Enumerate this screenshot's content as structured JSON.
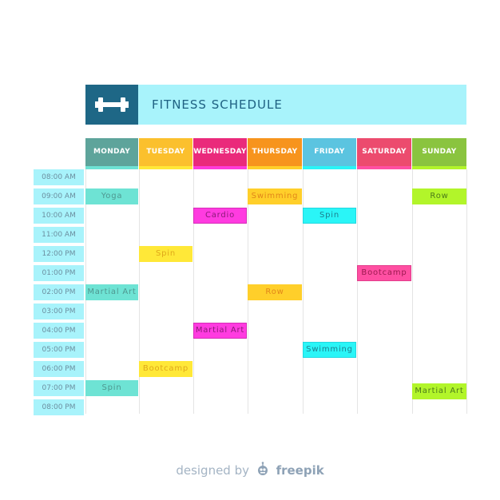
{
  "header": {
    "title": "FITNESS SCHEDULE",
    "icon": "dumbbell-icon",
    "colors": {
      "band": "#a8f3fb",
      "logo_box": "#1e6786",
      "title_text": "#1f6283"
    }
  },
  "days": [
    {
      "label": "MONDAY",
      "color": "#5ea49b",
      "strip": "#6ee3d4"
    },
    {
      "label": "TUESDAY",
      "color": "#fbc02d",
      "strip": "#ffe838"
    },
    {
      "label": "WEDNESDAY",
      "color": "#ea2a7b",
      "strip": "#ff3bd9"
    },
    {
      "label": "THURSDAY",
      "color": "#f7941d",
      "strip": "#ffcf2a"
    },
    {
      "label": "FRIDAY",
      "color": "#5bc4e0",
      "strip": "#2af5f7"
    },
    {
      "label": "SATURDAY",
      "color": "#ec4b6e",
      "strip": "#ff4fa2"
    },
    {
      "label": "SUNDAY",
      "color": "#8ac43f",
      "strip": "#b2f52a"
    }
  ],
  "times": [
    "08:00 AM",
    "09:00 AM",
    "10:00 AM",
    "11:00 AM",
    "12:00 PM",
    "01:00 PM",
    "02:00 PM",
    "03:00 PM",
    "04:00 PM",
    "05:00 PM",
    "06:00 PM",
    "07:00 PM",
    "08:00 PM"
  ],
  "entries": [
    {
      "day": 0,
      "slot": 1,
      "label": "Yoga",
      "bg": "#6ee3d4",
      "border": "#6ee3d4",
      "text": "#4f9790"
    },
    {
      "day": 0,
      "slot": 6,
      "label": "Martial Art",
      "bg": "#6ee3d4",
      "border": "#6ee3d4",
      "text": "#4f9790"
    },
    {
      "day": 0,
      "slot": 11,
      "label": "Spin",
      "bg": "#6ee3d4",
      "border": "#6ee3d4",
      "text": "#4f9790"
    },
    {
      "day": 1,
      "slot": 4,
      "label": "Spin",
      "bg": "#ffe838",
      "border": "#ffe838",
      "text": "#e0a81a"
    },
    {
      "day": 1,
      "slot": 10,
      "label": "Bootcamp",
      "bg": "#ffe838",
      "border": "#ffe838",
      "text": "#e0a81a"
    },
    {
      "day": 2,
      "slot": 2,
      "label": "Cardio",
      "bg": "#ff3be0",
      "border": "#d62cb8",
      "text": "#8a1a78"
    },
    {
      "day": 2,
      "slot": 8,
      "label": "Martial Art",
      "bg": "#ff3be0",
      "border": "#d62cb8",
      "text": "#8a1a78"
    },
    {
      "day": 3,
      "slot": 1,
      "label": "Swimming",
      "bg": "#ffcf2a",
      "border": "#ffcf2a",
      "text": "#e2861a"
    },
    {
      "day": 3,
      "slot": 6,
      "label": "Row",
      "bg": "#ffcf2a",
      "border": "#ffcf2a",
      "text": "#e2861a"
    },
    {
      "day": 4,
      "slot": 2,
      "label": "Spin",
      "bg": "#2af5f7",
      "border": "#22d8e0",
      "text": "#1d7f8f"
    },
    {
      "day": 4,
      "slot": 9,
      "label": "Swimming",
      "bg": "#2af5f7",
      "border": "#22d8e0",
      "text": "#1d7f8f"
    },
    {
      "day": 5,
      "slot": 5,
      "label": "Bootcamp",
      "bg": "#ff4fa2",
      "border": "#e23d8c",
      "text": "#9b1a4f"
    },
    {
      "day": 6,
      "slot": 1,
      "label": "Row",
      "bg": "#b2f52a",
      "border": "#b2f52a",
      "text": "#4c7a1a"
    },
    {
      "day": 6,
      "slot": 11.17,
      "label": "Martial Art",
      "bg": "#b2f52a",
      "border": "#b2f52a",
      "text": "#4c7a1a"
    }
  ],
  "footer": {
    "prefix": "designed by",
    "brand": "freepik",
    "icon": "freepik-logo-icon"
  }
}
